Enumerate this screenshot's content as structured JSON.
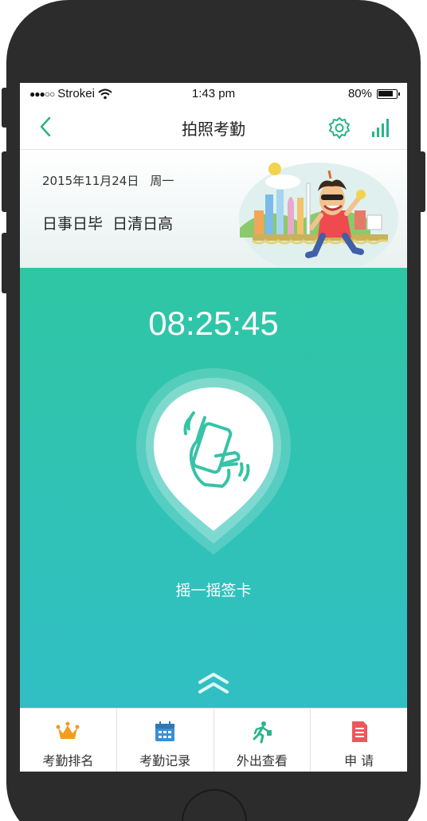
{
  "status_bar": {
    "carrier": "Strokei",
    "time": "1:43 pm",
    "battery": "80%",
    "icons": [
      "signal-dots-icon",
      "wifi-icon",
      "battery-icon"
    ]
  },
  "nav": {
    "title": "拍照考勤",
    "icons": [
      "back-chevron-icon",
      "gear-icon",
      "signal-bars-icon"
    ]
  },
  "header": {
    "date": "2015年11月24日",
    "weekday": "周一",
    "motto": "日事日毕  日清日高"
  },
  "main": {
    "time": "08:25:45",
    "shake_label": "摇一摇签卡",
    "icons": [
      "shake-phone-icon",
      "expand-up-icon"
    ]
  },
  "tabs": [
    {
      "label": "考勤排名",
      "icon": "crown-icon",
      "color": "#f39c1e"
    },
    {
      "label": "考勤记录",
      "icon": "calendar-icon",
      "color": "#3a8fd6"
    },
    {
      "label": "外出查看",
      "icon": "running-man-icon",
      "color": "#2bb38a"
    },
    {
      "label": "申 请",
      "icon": "document-icon",
      "color": "#f0555a"
    }
  ],
  "colors": {
    "accent": "#2bb38a",
    "main_top": "#2fc6a4",
    "main_bottom": "#31bfc4"
  }
}
